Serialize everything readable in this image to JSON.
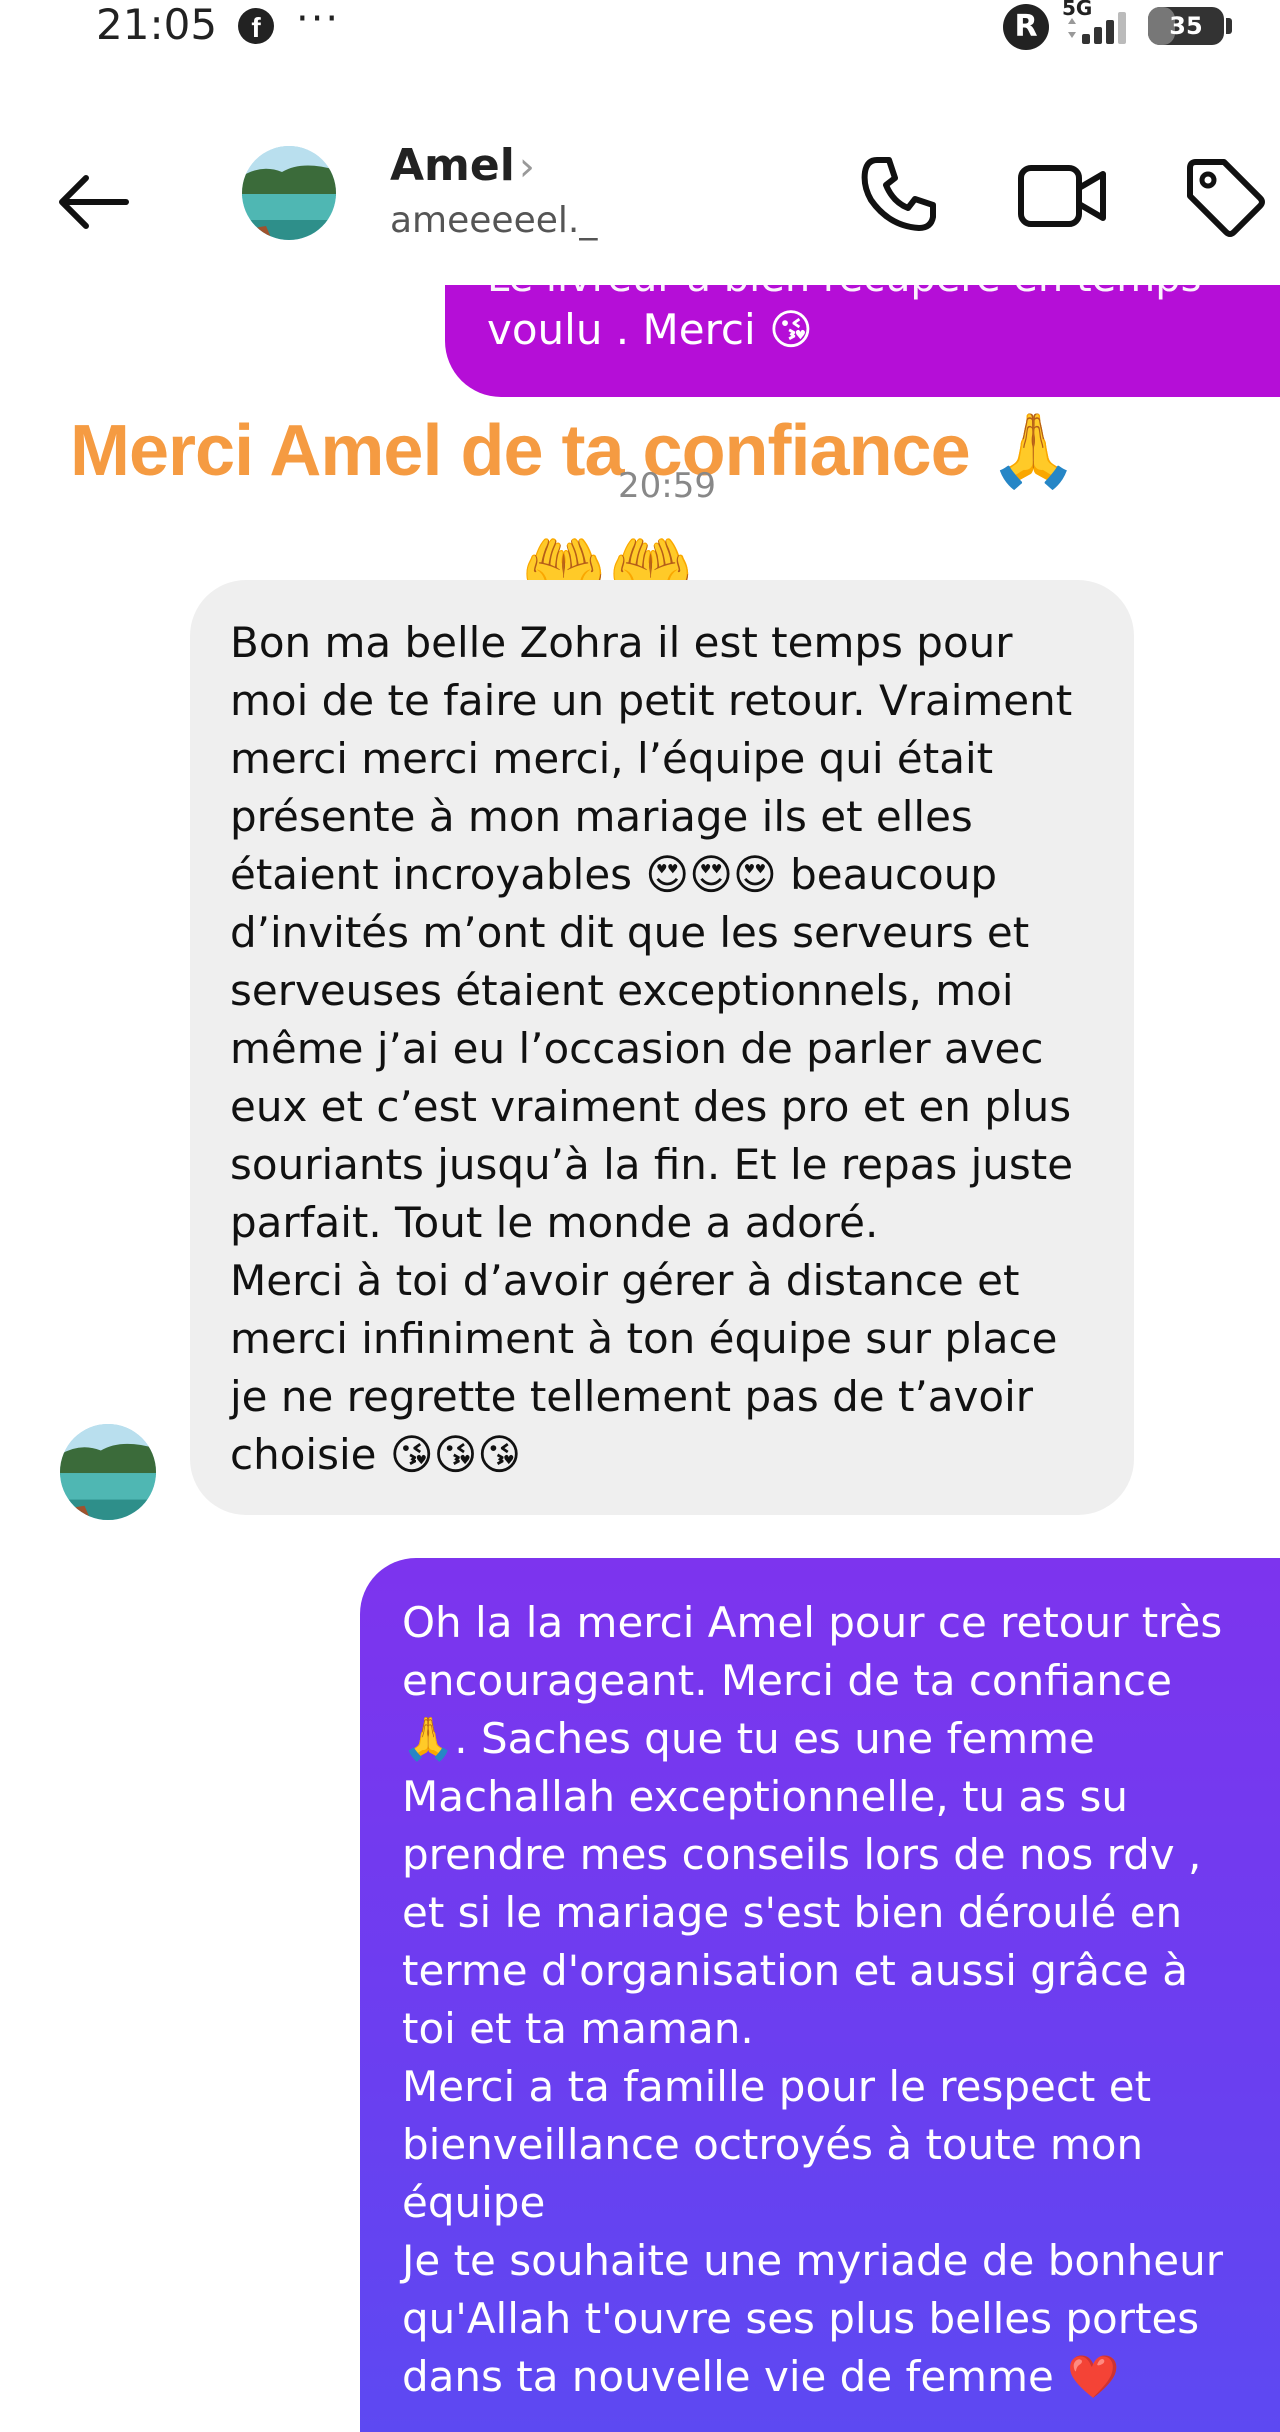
{
  "status_bar": {
    "time": "21:05",
    "facebook_icon": "f",
    "more_dots": "···",
    "r_icon": "R",
    "network": "5G",
    "battery": "35",
    "battery_level": 0.35
  },
  "header": {
    "back_icon": "arrow-left-icon",
    "name": "Amel",
    "chevron": "›",
    "username": "ameeeeel._",
    "call_icon": "phone-icon",
    "video_icon": "video-camera-icon",
    "tag_icon": "tag-icon"
  },
  "messages": {
    "top_cut_text": "Le livreur a bien récupéré en temps",
    "top_text": "voulu . Merci 😘",
    "reply_headline": "Merci Amel de ta confiance 🙏",
    "timestamp": "20:59",
    "reaction_emojis": "🤲🤲",
    "incoming_text": "Bon ma belle Zohra il est temps pour\nmoi de te faire un petit retour. Vraiment\nmerci merci merci, l’équipe qui était\nprésente à mon mariage ils et elles\nétaient incroyables 😍😍😍 beaucoup\nd’invités m’ont dit que les serveurs et\nserveuses étaient exceptionnels, moi\nmême j’ai eu l’occasion de parler avec\neux et c’est vraiment des pro et en plus\nsouriants jusqu’à la fin. Et le repas juste\nparfait. Tout le monde a adoré.\nMerci à toi d’avoir gérer à distance et\nmerci infiniment à ton équipe sur place\nje ne regrette tellement pas de t’avoir\nchoisie 😘😘😘",
    "outgoing_text": "Oh la la merci Amel pour ce retour très\nencourageant. Merci de ta confiance\n🙏. Saches que tu es une femme\nMachallah exceptionnelle, tu as su\nprendre mes conseils lors de nos rdv ,\net si le mariage s'est bien déroulé en\nterme d'organisation et aussi grâce à\ntoi et ta maman.\nMerci a ta famille pour le respect et\nbienveillance octroyés à toute mon\néquipe\nJe te souhaite une myriade de bonheur\nqu'Allah t'ouvre ses plus belles portes\ndans ta nouvelle vie de femme ❤️"
  },
  "colors": {
    "outgoing_top_bubble": "#b50ed7",
    "outgoing_bubble_gradient": [
      "#7d34ee",
      "#5d49f2"
    ],
    "incoming_bubble": "#efefef",
    "headline": "#f59b42"
  }
}
